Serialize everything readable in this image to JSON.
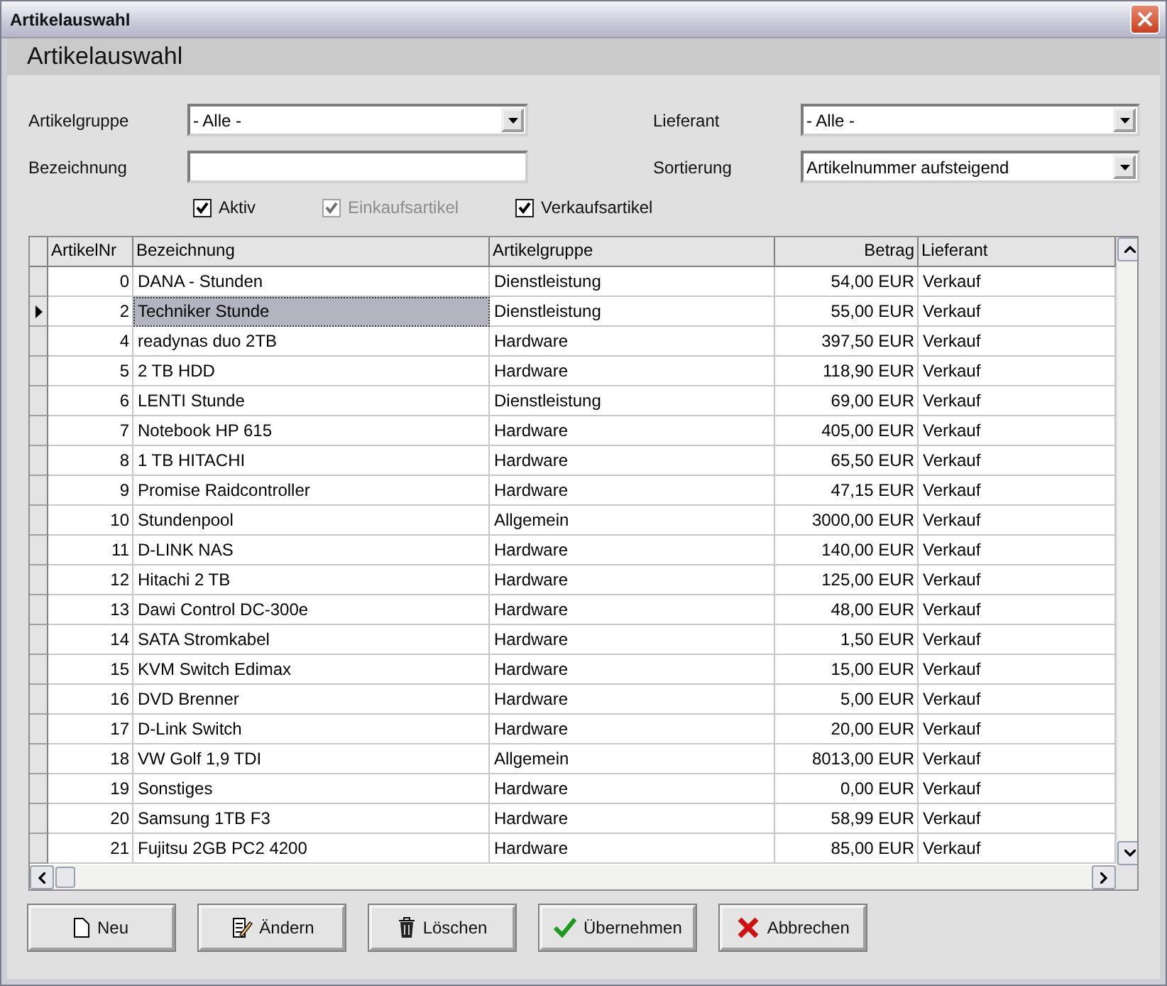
{
  "window": {
    "title": "Artikelauswahl"
  },
  "header": "Artikelauswahl",
  "filters": [
    {
      "kind": "dropdown",
      "label": "Artikelgruppe",
      "value": "- Alle -"
    },
    {
      "kind": "dropdown",
      "label": "Lieferant",
      "value": "- Alle -"
    },
    {
      "kind": "text",
      "label": "Bezeichnung"
    },
    {
      "kind": "dropdown",
      "label": "Sortierung",
      "value": "Artikelnummer aufsteigend"
    }
  ],
  "checkboxes": [
    {
      "label": "Aktiv",
      "checked": true,
      "disabled": false
    },
    {
      "label": "Einkaufsartikel",
      "checked": true,
      "disabled": true
    },
    {
      "label": "Verkaufsartikel",
      "checked": true,
      "disabled": false
    }
  ],
  "table": {
    "columns": [
      "ArtikelNr",
      "Bezeichnung",
      "Artikelgruppe",
      "Betrag",
      "Lieferant"
    ],
    "rows": [
      {
        "cells": [
          "0",
          "DANA - Stunden",
          "Dienstleistung",
          "54,00 EUR",
          "Verkauf"
        ],
        "selected": false
      },
      {
        "cells": [
          "2",
          "Techniker Stunde",
          "Dienstleistung",
          "55,00 EUR",
          "Verkauf"
        ],
        "selected": true
      },
      {
        "cells": [
          "4",
          "readynas duo 2TB",
          "Hardware",
          "397,50 EUR",
          "Verkauf"
        ],
        "selected": false
      },
      {
        "cells": [
          "5",
          "2 TB HDD",
          "Hardware",
          "118,90 EUR",
          "Verkauf"
        ],
        "selected": false
      },
      {
        "cells": [
          "6",
          "LENTI Stunde",
          "Dienstleistung",
          "69,00 EUR",
          "Verkauf"
        ],
        "selected": false
      },
      {
        "cells": [
          "7",
          "Notebook HP 615",
          "Hardware",
          "405,00 EUR",
          "Verkauf"
        ],
        "selected": false
      },
      {
        "cells": [
          "8",
          "1 TB HITACHI",
          "Hardware",
          "65,50 EUR",
          "Verkauf"
        ],
        "selected": false
      },
      {
        "cells": [
          "9",
          "Promise Raidcontroller",
          "Hardware",
          "47,15 EUR",
          "Verkauf"
        ],
        "selected": false
      },
      {
        "cells": [
          "10",
          "Stundenpool",
          "Allgemein",
          "3000,00 EUR",
          "Verkauf"
        ],
        "selected": false
      },
      {
        "cells": [
          "11",
          "D-LINK NAS",
          "Hardware",
          "140,00 EUR",
          "Verkauf"
        ],
        "selected": false
      },
      {
        "cells": [
          "12",
          "Hitachi 2 TB",
          "Hardware",
          "125,00 EUR",
          "Verkauf"
        ],
        "selected": false
      },
      {
        "cells": [
          "13",
          "Dawi Control DC-300e",
          "Hardware",
          "48,00 EUR",
          "Verkauf"
        ],
        "selected": false
      },
      {
        "cells": [
          "14",
          "SATA Stromkabel",
          "Hardware",
          "1,50 EUR",
          "Verkauf"
        ],
        "selected": false
      },
      {
        "cells": [
          "15",
          "KVM Switch Edimax",
          "Hardware",
          "15,00 EUR",
          "Verkauf"
        ],
        "selected": false
      },
      {
        "cells": [
          "16",
          "DVD Brenner",
          "Hardware",
          "5,00 EUR",
          "Verkauf"
        ],
        "selected": false
      },
      {
        "cells": [
          "17",
          "D-Link Switch",
          "Hardware",
          "20,00 EUR",
          "Verkauf"
        ],
        "selected": false
      },
      {
        "cells": [
          "18",
          "VW Golf 1,9 TDI",
          "Allgemein",
          "8013,00 EUR",
          "Verkauf"
        ],
        "selected": false
      },
      {
        "cells": [
          "19",
          "Sonstiges",
          "Hardware",
          "0,00 EUR",
          "Verkauf"
        ],
        "selected": false
      },
      {
        "cells": [
          "20",
          "Samsung 1TB F3",
          "Hardware",
          "58,99 EUR",
          "Verkauf"
        ],
        "selected": false
      },
      {
        "cells": [
          "21",
          "Fujitsu 2GB PC2 4200",
          "Hardware",
          "85,00 EUR",
          "Verkauf"
        ],
        "selected": false
      }
    ]
  },
  "buttons": [
    {
      "kind": "new",
      "label": "Neu"
    },
    {
      "kind": "edit",
      "label": "Ändern"
    },
    {
      "kind": "delete",
      "label": "Löschen"
    },
    {
      "kind": "apply",
      "label": "Übernehmen"
    },
    {
      "kind": "cancel",
      "label": "Abbrechen"
    }
  ]
}
